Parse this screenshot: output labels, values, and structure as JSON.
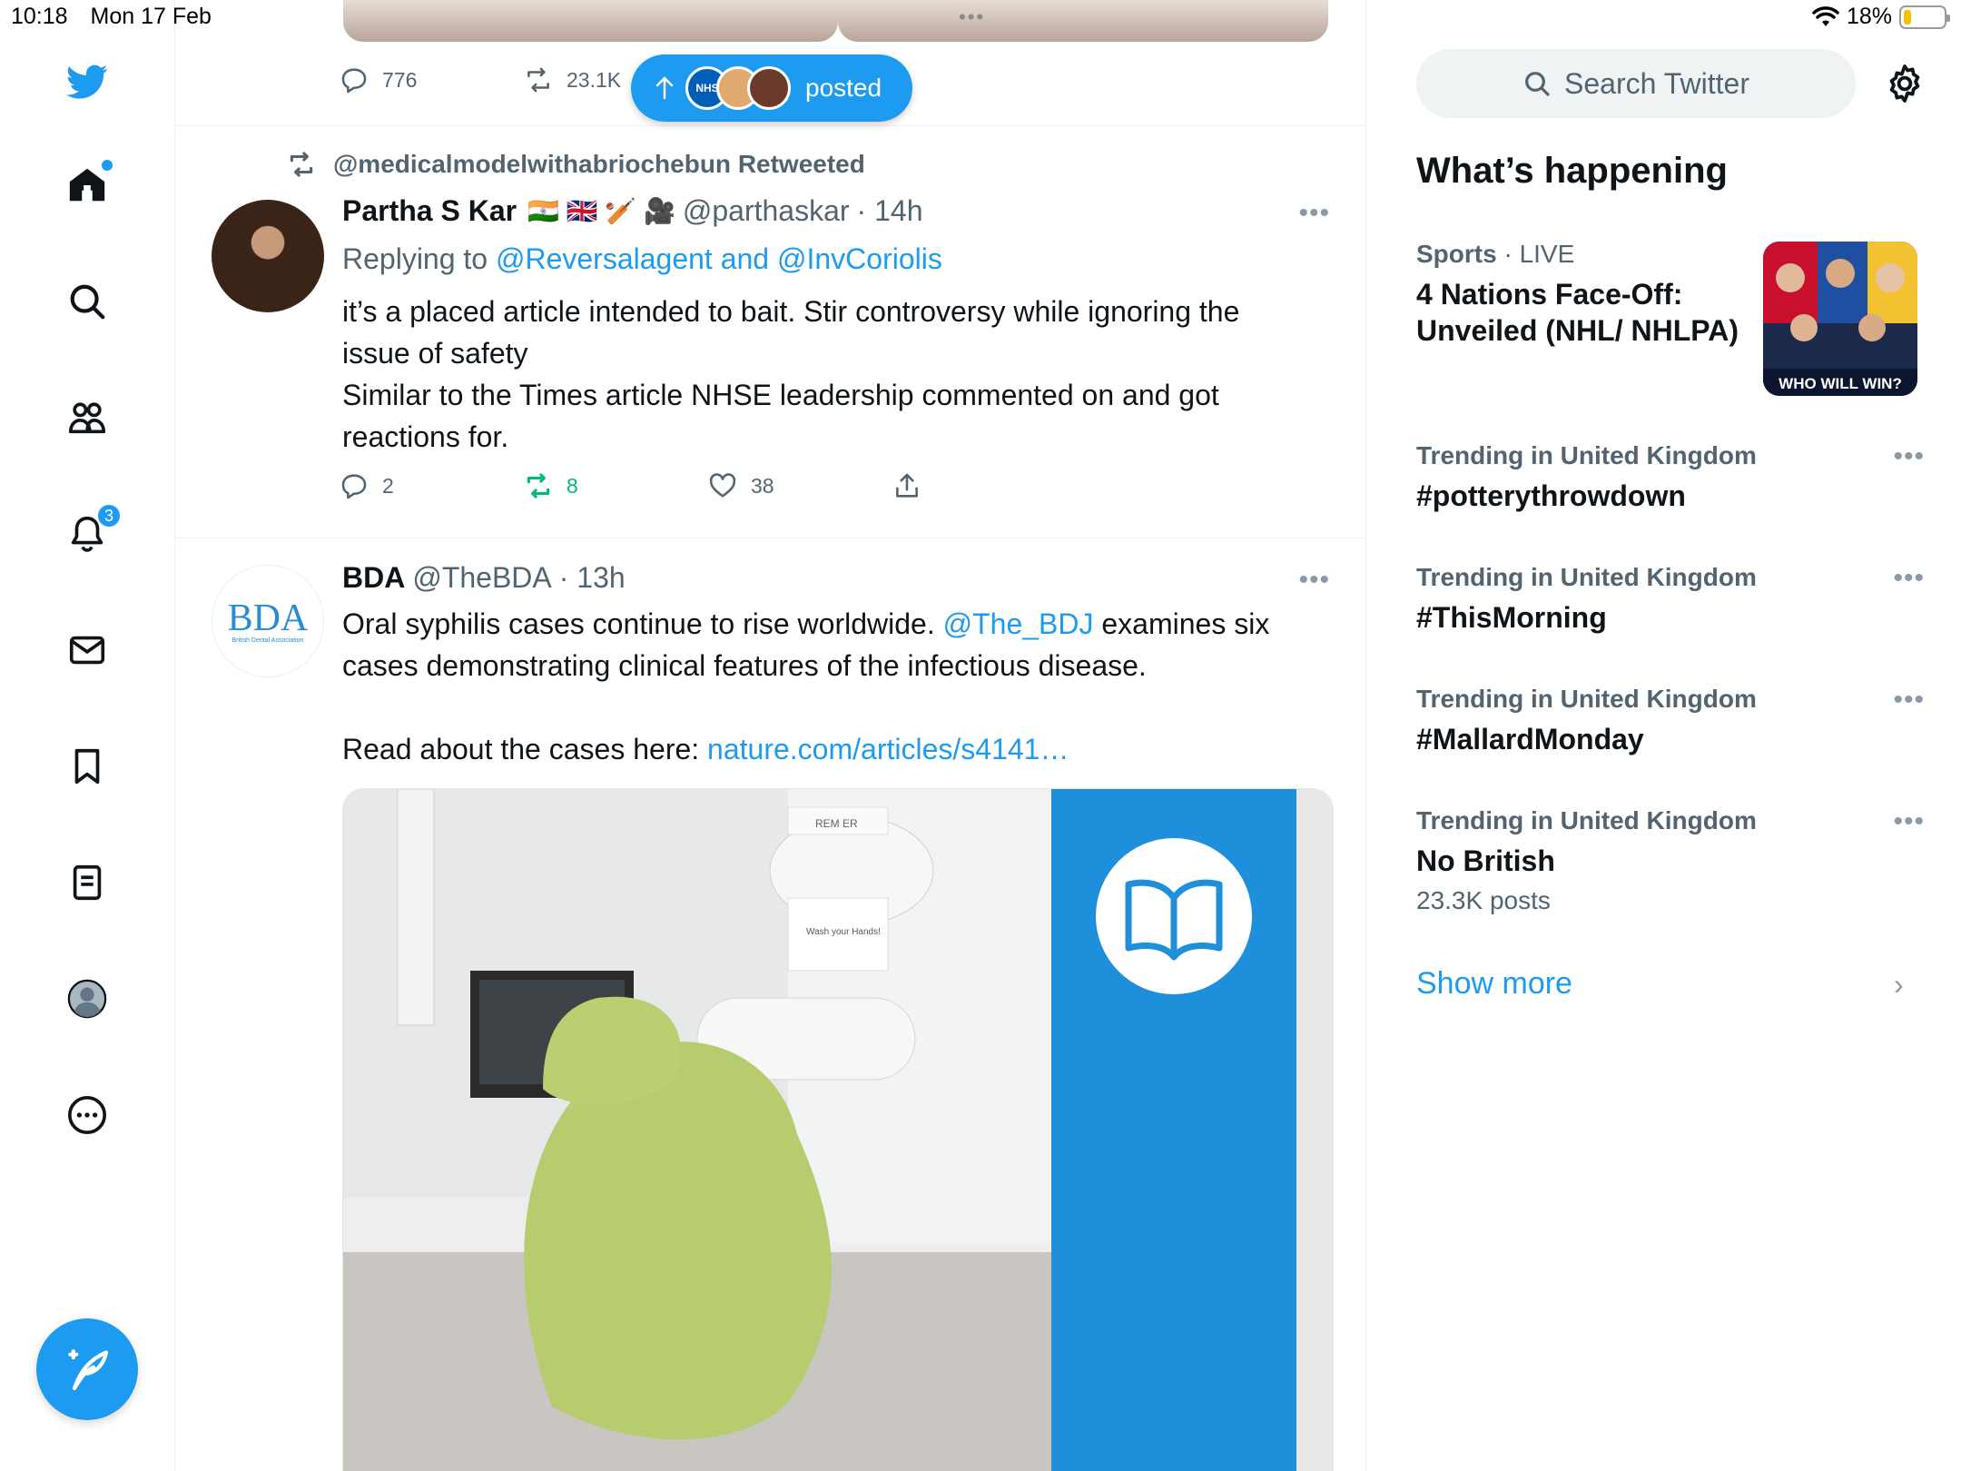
{
  "colors": {
    "accent": "#1d9bf0",
    "retweet_green": "#00ba7c",
    "text": "#0f1419",
    "muted": "#536471",
    "battery_fill": "#f5c400"
  },
  "status_bar": {
    "time": "10:18",
    "date": "Mon 17 Feb",
    "battery": "18%",
    "battery_level": 0.18
  },
  "nav": {
    "icons": [
      "twitter-logo",
      "home-icon",
      "search-icon",
      "communities-icon",
      "notifications-icon",
      "messages-icon",
      "bookmarks-icon",
      "lists-icon",
      "profile-icon",
      "more-icon"
    ],
    "notifications_badge": "3"
  },
  "prev_tweet": {
    "replies": "776",
    "retweets": "23.1K"
  },
  "new_posts_pill": {
    "label": "posted",
    "avatar_text": [
      "NHS",
      "",
      ""
    ]
  },
  "tweet1": {
    "retweeted_by": "@medicalmodelwithabriochebun Retweeted",
    "name": "Partha S Kar",
    "flags": "🇮🇳 🇬🇧 🏏 🎥",
    "handle": "@parthaskar",
    "time": "· 14h",
    "replying_prefix": "Replying to ",
    "replying_to": "@Reversalagent and @InvCoriolis",
    "text_line1": "it’s a placed article intended to bait. Stir controversy while ignoring the",
    "text_line2": "issue of safety",
    "text_line3": "Similar to the Times article NHSE leadership commented on and got",
    "text_line4": "reactions for.",
    "replies": "2",
    "retweets": "8",
    "likes": "38"
  },
  "tweet2": {
    "avatar_text": "BDA",
    "avatar_subtext": "British Dental Association",
    "name": "BDA",
    "handle": "@TheBDA",
    "time": "· 13h",
    "text_part1": "Oral syphilis cases continue to rise worldwide. ",
    "mention": "@The_BDJ",
    "text_part2": " examines six",
    "text_line2": "cases demonstrating clinical features of the infectious disease.",
    "read_prefix": "Read about the cases here: ",
    "link": "nature.com/articles/s4141…",
    "media_sign_text": "Wash your Hands!",
    "media_reminder_text": "REM    ER"
  },
  "sidebar": {
    "search_placeholder": "Search Twitter",
    "title": "What’s happening",
    "sports": {
      "category": "Sports",
      "status": "· LIVE",
      "title": "4 Nations Face-Off: Unveiled (NHL/ NHLPA)",
      "thumb_caption": "WHO WILL WIN?"
    },
    "trends": [
      {
        "context": "Trending in United Kingdom",
        "tag": "#potterythrowdown",
        "count": ""
      },
      {
        "context": "Trending in United Kingdom",
        "tag": "#ThisMorning",
        "count": ""
      },
      {
        "context": "Trending in United Kingdom",
        "tag": "#MallardMonday",
        "count": ""
      },
      {
        "context": "Trending in United Kingdom",
        "tag": "No British",
        "count": "23.3K posts"
      }
    ],
    "show_more": "Show more"
  }
}
